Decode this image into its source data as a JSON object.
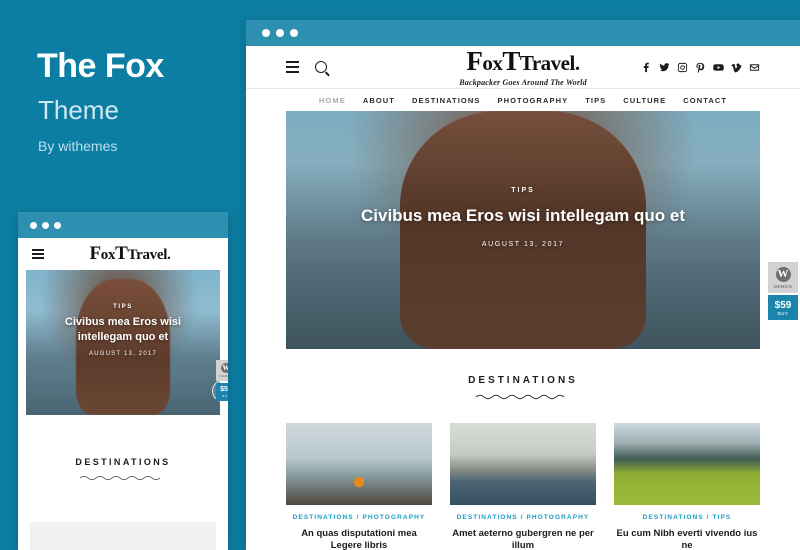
{
  "promo": {
    "title": "The Fox",
    "subtitle": "Theme",
    "byline": "By withemes"
  },
  "site": {
    "brand_fox": "Fox",
    "brand_travel": "Travel.",
    "brand_full": "FoxTravel.",
    "tagline": "Backpacker Goes Around The World",
    "menu": [
      {
        "label": "HOME",
        "active": true
      },
      {
        "label": "ABOUT",
        "active": false
      },
      {
        "label": "DESTINATIONS",
        "active": false
      },
      {
        "label": "PHOTOGRAPHY",
        "active": false
      },
      {
        "label": "TIPS",
        "active": false
      },
      {
        "label": "CULTURE",
        "active": false
      },
      {
        "label": "CONTACT",
        "active": false
      }
    ],
    "social": [
      {
        "name": "facebook-icon"
      },
      {
        "name": "twitter-icon"
      },
      {
        "name": "instagram-icon"
      },
      {
        "name": "pinterest-icon"
      },
      {
        "name": "youtube-icon"
      },
      {
        "name": "vimeo-icon"
      },
      {
        "name": "email-icon"
      }
    ],
    "icons": {
      "menu": "hamburger-icon",
      "search": "search-icon"
    },
    "hero": {
      "category": "TIPS",
      "title": "Civibus mea Eros wisi intellegam quo et",
      "date": "AUGUST 13, 2017",
      "next_arrow": "›"
    },
    "section": {
      "title": "DESTINATIONS"
    },
    "cards": [
      {
        "category": "DESTINATIONS / PHOTOGRAPHY",
        "title": "An quas disputationi mea Legere libris"
      },
      {
        "category": "DESTINATIONS / PHOTOGRAPHY",
        "title": "Amet aeterno gubergren ne per illum"
      },
      {
        "category": "DESTINATIONS / TIPS",
        "title": "Eu cum Nibh everti vivendo ius ne"
      }
    ]
  },
  "widgets": {
    "demo": {
      "glyph": "W",
      "label": "DEMOS"
    },
    "buy": {
      "price": "$59",
      "label": "BUY"
    }
  },
  "colors": {
    "background": "#0d7ea3",
    "titlebar": "#2e90b0",
    "accent": "#1b9fc4",
    "buy": "#1b84ab"
  }
}
